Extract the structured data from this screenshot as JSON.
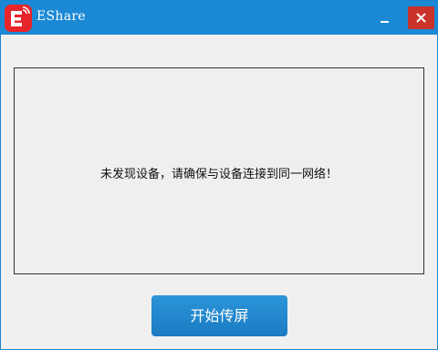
{
  "window": {
    "title": "EShare",
    "icon": "eshare-logo-icon",
    "accent_color": "#1b89d5",
    "close_color": "#c9332a"
  },
  "device_panel": {
    "message": "未发现设备，请确保与设备连接到同一网络！"
  },
  "actions": {
    "start_label": "开始传屏"
  }
}
